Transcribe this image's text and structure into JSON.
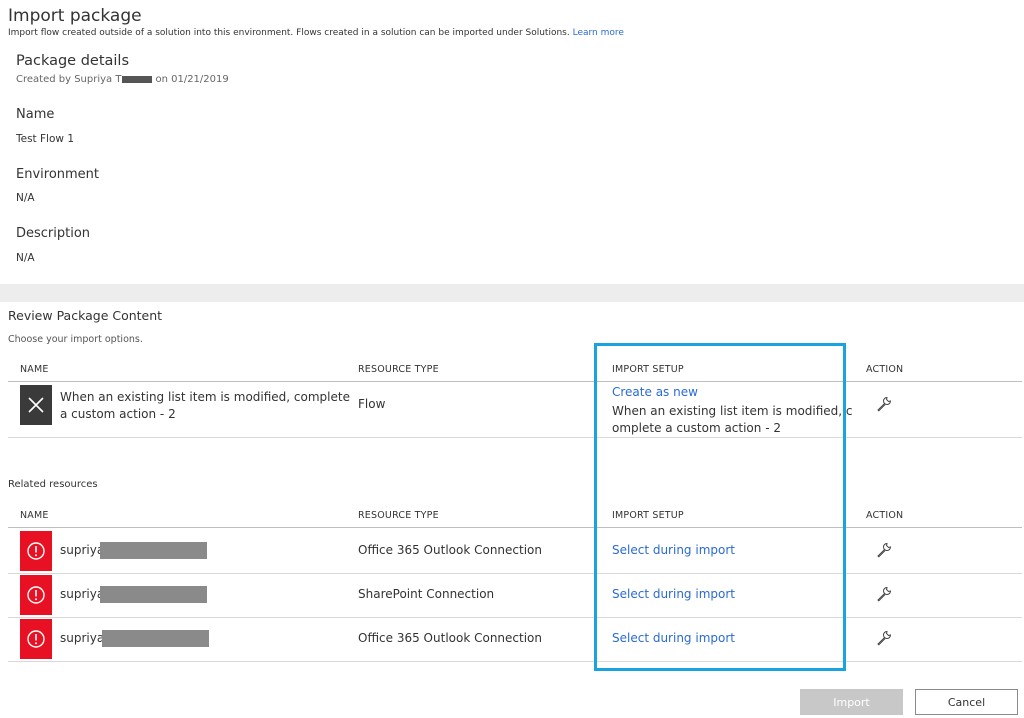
{
  "header": {
    "title": "Import package",
    "subtitle": "Import flow created outside of a solution into this environment. Flows created in a solution can be imported under Solutions.",
    "learn_more": "Learn more"
  },
  "package_details": {
    "heading": "Package details",
    "created_prefix": "Created by Supriya T",
    "created_suffix": "on 01/21/2019",
    "name_label": "Name",
    "name_value": "Test Flow 1",
    "environment_label": "Environment",
    "environment_value": "N/A",
    "description_label": "Description",
    "description_value": "N/A"
  },
  "review": {
    "title": "Review Package Content",
    "subtitle": "Choose your import options.",
    "columns": [
      "NAME",
      "RESOURCE TYPE",
      "IMPORT SETUP",
      "ACTION"
    ],
    "flow_row": {
      "name_line1": "When an existing list item is modified, complete",
      "name_line2": "a custom action - 2",
      "type": "Flow",
      "setup_link": "Create as new",
      "setup_line1": "When an existing list item is modified, c",
      "setup_line2": "omplete a custom action - 2"
    }
  },
  "related": {
    "title": "Related resources",
    "columns": [
      "NAME",
      "RESOURCE TYPE",
      "IMPORT SETUP",
      "ACTION"
    ],
    "rows": [
      {
        "name": "supriya",
        "type": "Office 365 Outlook Connection",
        "setup": "Select during import"
      },
      {
        "name": "supriya",
        "type": "SharePoint Connection",
        "setup": "Select during import"
      },
      {
        "name": "supriya",
        "type": "Office 365 Outlook Connection",
        "setup": "Select during import"
      }
    ]
  },
  "footer": {
    "import_label": "Import",
    "cancel_label": "Cancel"
  },
  "colors": {
    "link": "#2a6ad4",
    "error_tile": "#e81123",
    "flow_tile": "#3a3a3a",
    "highlight": "#1aa3df"
  }
}
